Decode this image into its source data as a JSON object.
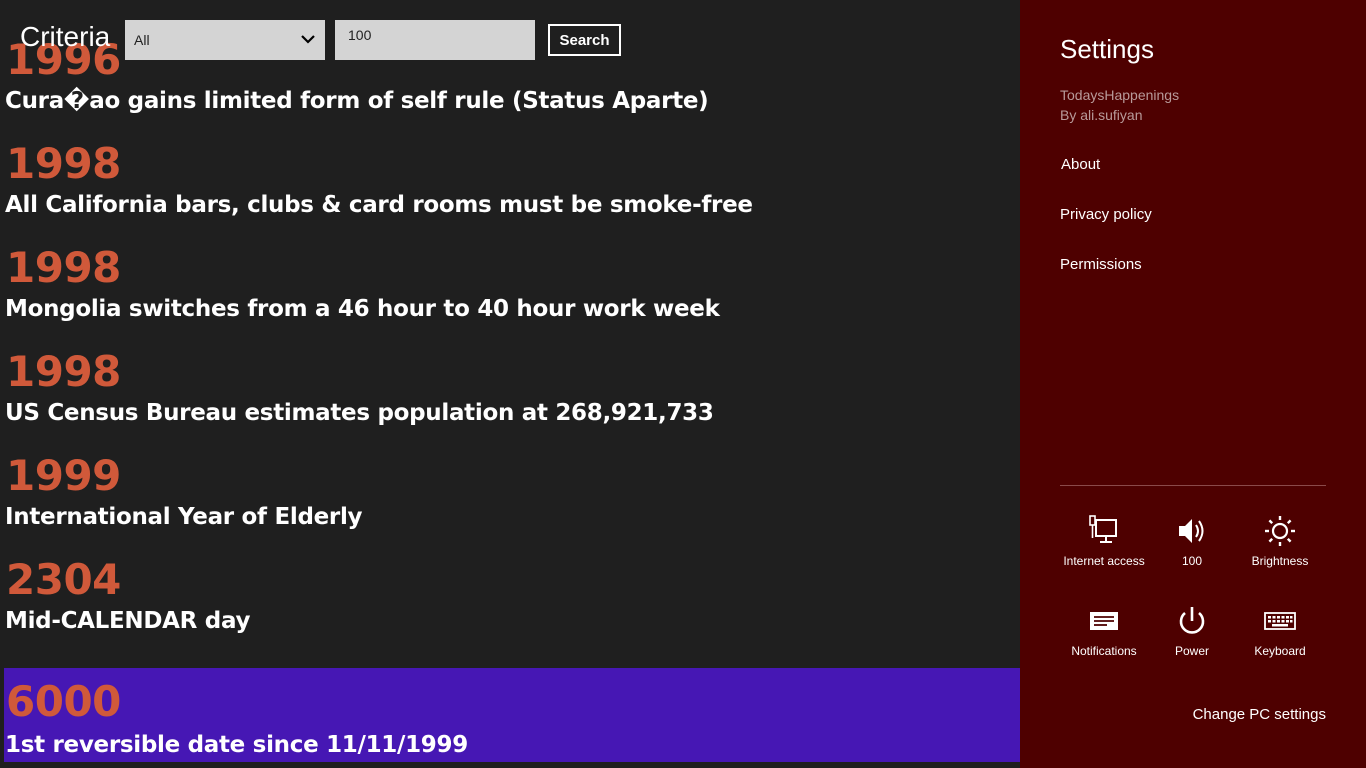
{
  "header": {
    "criteria_label": "Criteria",
    "criteria_value": "All",
    "search_value": "100",
    "search_button": "Search"
  },
  "items": [
    {
      "year": "1996",
      "event": "Cura�ao gains limited form of self rule (Status Aparte)"
    },
    {
      "year": "1998",
      "event": "All California bars, clubs & card rooms must be smoke-free"
    },
    {
      "year": "1998",
      "event": "Mongolia switches from a 46 hour to 40 hour work week"
    },
    {
      "year": "1998",
      "event": "US Census Bureau estimates population at 268,921,733"
    },
    {
      "year": "1999",
      "event": "International Year of Elderly"
    },
    {
      "year": "2304",
      "event": "Mid-CALENDAR day"
    },
    {
      "year": "6000",
      "event": "1st reversible date since 11/11/1999",
      "selected": true
    }
  ],
  "settings": {
    "title": "Settings",
    "app_name": "TodaysHappenings",
    "app_author": "By ali.sufiyan",
    "links": [
      "About",
      "Privacy policy",
      "Permissions"
    ],
    "quick": [
      {
        "label": "Internet access",
        "icon": "network-icon"
      },
      {
        "label": "100",
        "icon": "volume-icon"
      },
      {
        "label": "Brightness",
        "icon": "brightness-icon"
      },
      {
        "label": "Notifications",
        "icon": "notifications-icon"
      },
      {
        "label": "Power",
        "icon": "power-icon"
      },
      {
        "label": "Keyboard",
        "icon": "keyboard-icon"
      }
    ],
    "change_pc": "Change PC settings"
  },
  "colors": {
    "app_bg": "#1f1f1f",
    "year_accent": "#d0593a",
    "selected_bg": "#4617b4",
    "settings_bg": "#4e0000"
  }
}
